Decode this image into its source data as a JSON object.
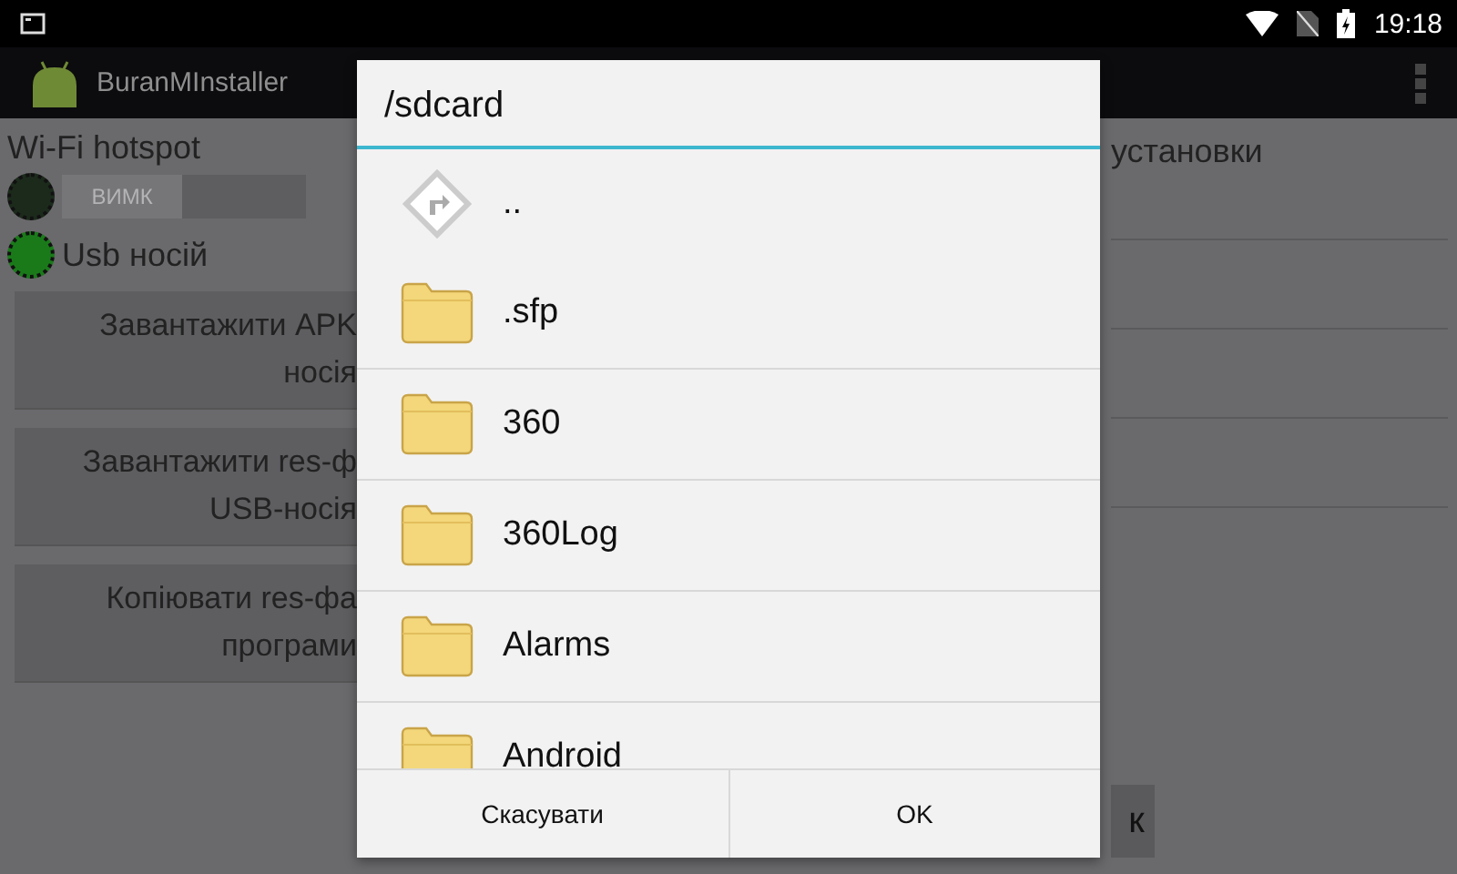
{
  "status_bar": {
    "time": "19:18"
  },
  "action_bar": {
    "title": "BuranMInstaller"
  },
  "main": {
    "hotspot_label": "Wi-Fi hotspot",
    "hotspot_led_on": false,
    "hotspot_switch": {
      "label": "ВИМК",
      "on": false
    },
    "usb_led_on": true,
    "usb_label": "Usb носій",
    "buttons": [
      {
        "lines": [
          "Завантажити APK",
          "носія"
        ]
      },
      {
        "lines": [
          "Завантажити res-ф",
          "USB-носія"
        ]
      },
      {
        "lines": [
          "Копіювати res-фа",
          "програми"
        ]
      }
    ],
    "right_heading": "установки",
    "partial_button": "к"
  },
  "dialog": {
    "title": "/sdcard",
    "items": [
      {
        "name": "..",
        "kind": "up"
      },
      {
        "name": ".sfp",
        "kind": "folder"
      },
      {
        "name": "360",
        "kind": "folder"
      },
      {
        "name": "360Log",
        "kind": "folder"
      },
      {
        "name": "Alarms",
        "kind": "folder"
      },
      {
        "name": "Android",
        "kind": "folder"
      }
    ],
    "buttons": [
      "Скасувати",
      "OK"
    ]
  }
}
